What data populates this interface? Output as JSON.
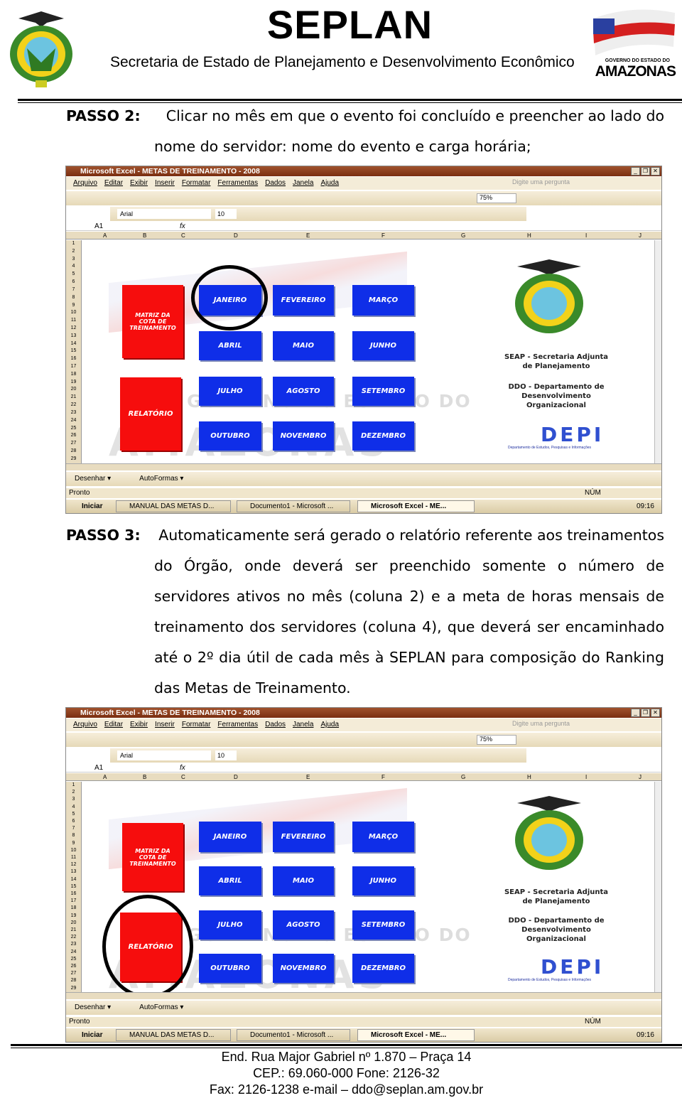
{
  "header": {
    "title": "SEPLAN",
    "subtitle": "Secretaria de Estado de Planejamento e Desenvolvimento Econômico",
    "right_logo_small": "GOVERNO DO ESTADO DO",
    "right_logo_big": "AMAZONAS"
  },
  "step2": {
    "label": "PASSO 2:",
    "first_line": "Clicar no mês em que o evento foi concluído e preencher ao lado do",
    "rest": "nome do servidor: nome do evento e carga horária;"
  },
  "step3": {
    "label": "PASSO 3:",
    "first_line": "Automaticamente será gerado o relatório referente aos treinamentos",
    "rest": "do Órgão, onde deverá ser preenchido somente o número de servidores ativos no mês (coluna 2) e a meta de horas mensais de treinamento dos servidores (coluna 4), que deverá ser encaminhado até o 2º dia útil de cada mês à SEPLAN para composição do Ranking das Metas de Treinamento."
  },
  "excel": {
    "window_title": "Microsoft Excel - METAS DE TREINAMENTO - 2008",
    "menu": [
      "Arquivo",
      "Editar",
      "Exibir",
      "Inserir",
      "Formatar",
      "Ferramentas",
      "Dados",
      "Janela",
      "Ajuda"
    ],
    "help_placeholder": "Digite uma pergunta",
    "zoom": "75%",
    "font": "Arial",
    "font_size": "10",
    "cell_ref": "A1",
    "fx": "fx",
    "columns": [
      "A",
      "B",
      "C",
      "D",
      "E",
      "F",
      "G",
      "H",
      "I",
      "J"
    ],
    "matriz_button": "MATRIZ DA\nCOTA DE\nTREINAMENTO",
    "relatorio_button": "RELATÓRIO",
    "months": [
      "JANEIRO",
      "FEVEREIRO",
      "MARÇO",
      "ABRIL",
      "MAIO",
      "JUNHO",
      "JULHO",
      "AGOSTO",
      "SETEMBRO",
      "OUTUBRO",
      "NOVEMBRO",
      "DEZEMBRO"
    ],
    "watermark": "GOVERNO DO ESTADO DO",
    "watermark2": "AMAZONAS",
    "seap": "SEAP - Secretaria Adjunta de Planejamento",
    "ddo": "DDO - Departamento de Desenvolvimento Organizacional",
    "depi": "DEPI",
    "depi_sub": "Departamento de Estudos, Pesquisas e Informações",
    "draw_toolbar": [
      "Desenhar ▾",
      "AutoFormas ▾"
    ],
    "status_left": "Pronto",
    "status_right": "NÚM",
    "start": "Iniciar",
    "tasks": [
      "MANUAL DAS METAS D...",
      "Documento1 - Microsoft ...",
      "Microsoft Excel - ME..."
    ],
    "clock": "09:16",
    "highlight_colors": {
      "month": "#0f2ee8",
      "red": "#f60d0d",
      "titlebar": "#8b3a1a"
    }
  },
  "footer": [
    "End. Rua Major Gabriel nº 1.870 –  Praça 14",
    "CEP.: 69.060-000 Fone: 2126-32",
    "Fax: 2126-1238 e-mail – ddo@seplan.am.gov.br"
  ]
}
